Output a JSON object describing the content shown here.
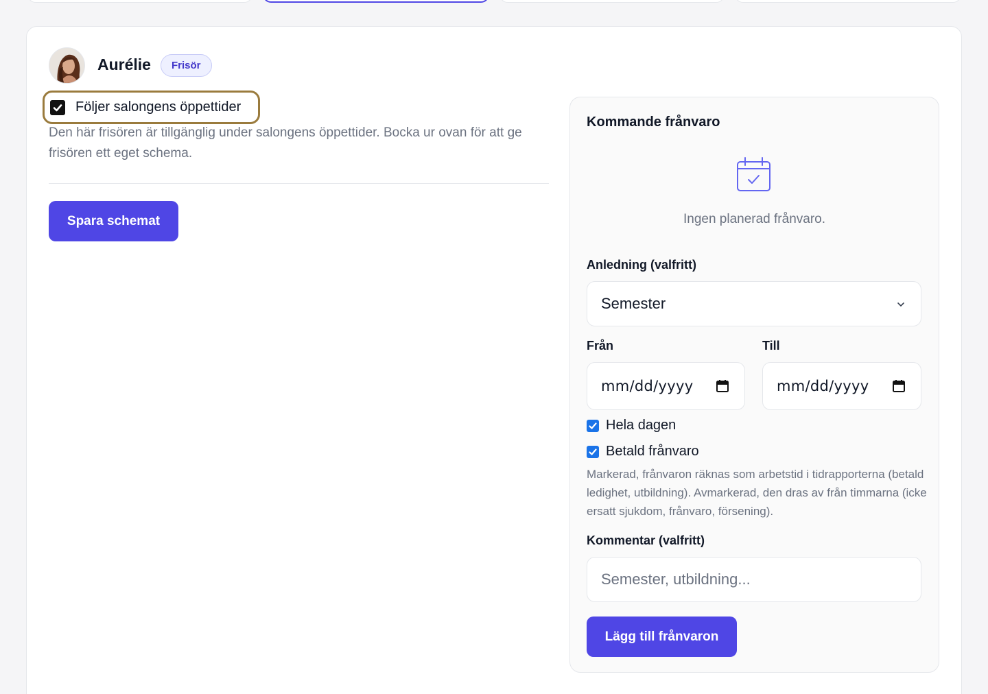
{
  "staff": {
    "name": "Aurélie",
    "role": "Frisör"
  },
  "schedule": {
    "follow_label": "Följer salongens öppettider",
    "follow_checked": true,
    "help_text": "Den här frisören är tillgänglig under salongens öppettider. Bocka ur ovan för att ge frisören ett eget schema.",
    "save_label": "Spara schemat"
  },
  "absence": {
    "title": "Kommande frånvaro",
    "empty_text": "Ingen planerad frånvaro.",
    "reason_label": "Anledning (valfritt)",
    "reason_value": "Semester",
    "from_label": "Från",
    "from_value": "mm/dd/yyyy",
    "to_label": "Till",
    "to_value": "mm/dd/yyyy",
    "all_day_label": "Hela dagen",
    "all_day_checked": true,
    "paid_label": "Betald frånvaro",
    "paid_checked": true,
    "paid_note": "Markerad, frånvaron räknas som arbetstid i tidrapporterna (betald ledighet, utbildning). Avmarkerad, den dras av från timmarna (icke ersatt sjukdom, frånvaro, försening).",
    "comment_label": "Kommentar (valfritt)",
    "comment_placeholder": "Semester, utbildning...",
    "add_label": "Lägg till frånvaron"
  },
  "colors": {
    "primary": "#4f46e5",
    "focus_ring": "#9a7b3d",
    "checkbox_blue": "#1a73e8"
  }
}
